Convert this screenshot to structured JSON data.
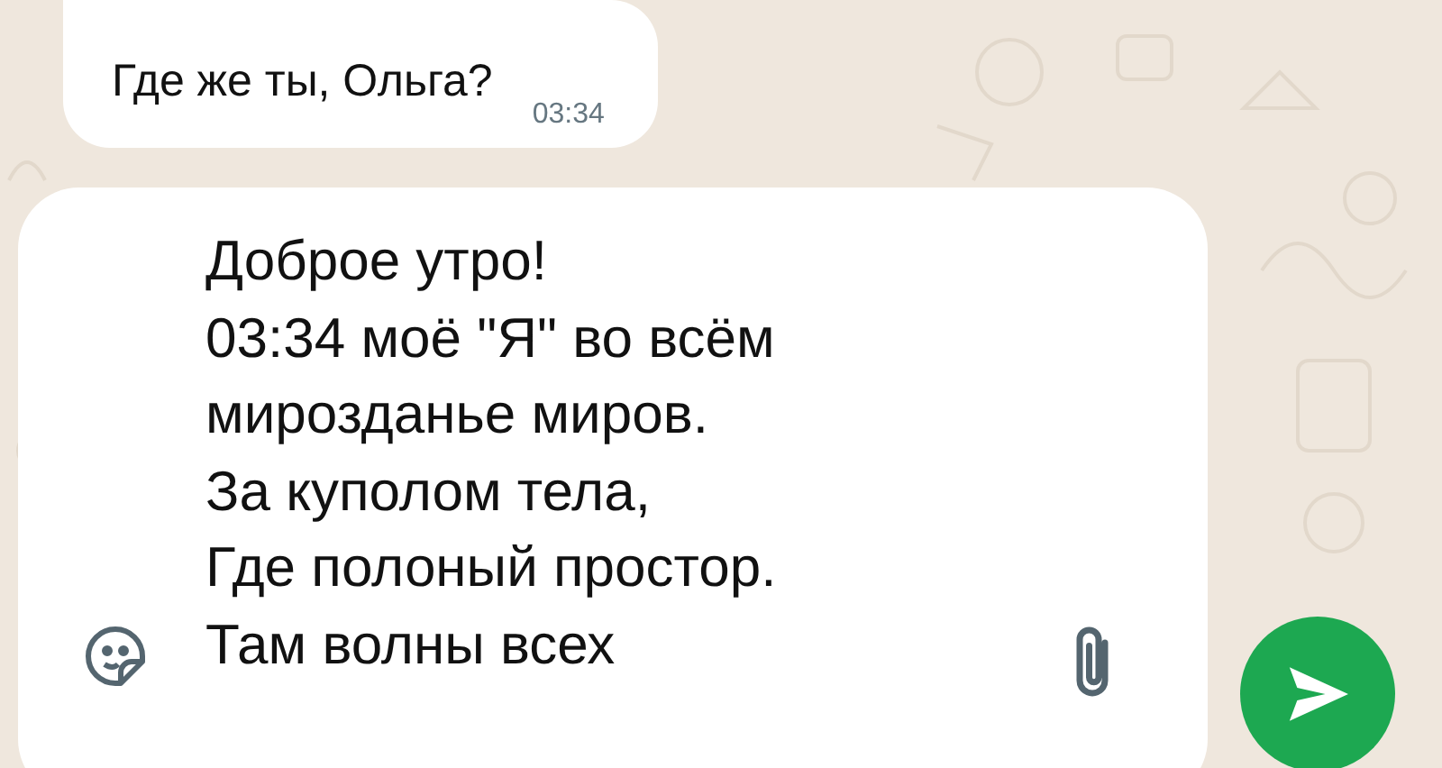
{
  "messages": [
    {
      "text": "Где же ты, Ольга?",
      "time": "03:34"
    }
  ],
  "composer": {
    "value_lines": [
      "Доброе утро!",
      "03:34 моё \"Я\" во всём",
      "мирозданье миров.",
      "За куполом тела,",
      "Где полоный простор.",
      "Там волны всех"
    ]
  }
}
